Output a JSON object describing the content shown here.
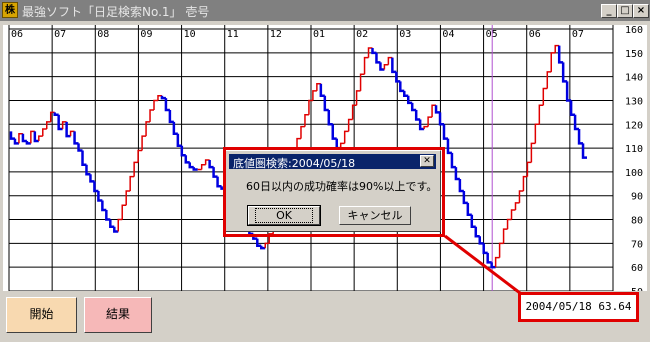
{
  "window": {
    "title": "最強ソフト「日足検索No.1」 壱号",
    "icon": "app-logo-icon",
    "controls": [
      "_",
      "□",
      "×"
    ]
  },
  "chart_data": {
    "type": "line",
    "x_tick_labels": [
      "06",
      "07",
      "08",
      "09",
      "10",
      "11",
      "12",
      "01",
      "02",
      "03",
      "04",
      "05",
      "06",
      "07"
    ],
    "y_tick_labels": [
      "160",
      "150",
      "140",
      "130",
      "120",
      "110",
      "100",
      "90",
      "80",
      "70",
      "60",
      "50"
    ],
    "ylim": [
      50,
      160
    ],
    "grid": true,
    "colors": {
      "up": "#e00000",
      "down": "#0000e0",
      "marker": "#b050d0"
    },
    "marker_label": "2004/05/18",
    "series": [
      {
        "x": [
          0,
          2,
          4,
          6,
          8,
          10,
          12,
          14,
          16,
          18,
          20,
          22,
          24,
          26,
          28,
          30,
          32,
          34,
          36,
          38,
          40,
          42,
          44,
          46,
          48,
          50,
          52,
          54,
          56,
          58,
          60,
          62,
          64,
          66,
          68,
          70,
          72,
          74,
          76,
          78,
          80,
          82,
          84,
          86,
          88,
          90,
          92,
          94,
          96,
          98,
          100,
          102,
          104,
          106,
          108,
          110,
          112,
          114,
          116,
          118,
          120,
          122,
          124,
          126,
          128,
          130,
          132,
          134,
          136,
          138,
          140,
          142,
          144,
          146,
          148,
          150,
          152,
          154,
          156,
          158,
          160,
          162,
          164,
          166,
          168,
          170,
          172,
          174,
          176,
          178,
          180,
          182,
          184,
          186,
          188,
          190,
          192,
          194,
          196,
          198,
          200,
          202,
          204,
          206,
          208,
          210,
          212,
          214,
          216,
          218,
          220,
          222,
          224,
          226,
          228,
          230,
          232,
          234,
          236,
          238,
          240,
          242,
          244,
          246,
          248,
          250,
          252,
          254,
          256,
          258,
          260,
          262,
          264,
          266,
          268,
          270,
          272,
          274,
          276,
          278,
          280,
          282,
          284,
          286,
          288,
          290
        ],
        "values": [
          117,
          114,
          112,
          116,
          113,
          112,
          117,
          113,
          115,
          118,
          121,
          125,
          124,
          118,
          121,
          115,
          117,
          112,
          109,
          103,
          99,
          96,
          92,
          88,
          84,
          80,
          77,
          75,
          80,
          86,
          92,
          98,
          104,
          109,
          115,
          121,
          126,
          130,
          132,
          131,
          126,
          121,
          116,
          111,
          107,
          104,
          102,
          101,
          101,
          103,
          105,
          102,
          98,
          94,
          93,
          94,
          90,
          86,
          82,
          79,
          77,
          74,
          72,
          69,
          68,
          70,
          74,
          80,
          86,
          92,
          98,
          103,
          108,
          114,
          119,
          124,
          130,
          134,
          137,
          132,
          126,
          120,
          114,
          110,
          112,
          117,
          122,
          128,
          134,
          141,
          148,
          152,
          150,
          146,
          143,
          145,
          148,
          142,
          138,
          134,
          132,
          129,
          126,
          122,
          118,
          119,
          123,
          128,
          125,
          120,
          114,
          108,
          102,
          97,
          92,
          87,
          82,
          77,
          73,
          70,
          66,
          62,
          60,
          64,
          70,
          76,
          80,
          84,
          87,
          92,
          98,
          104,
          112,
          120,
          128,
          135,
          142,
          150,
          153,
          146,
          138,
          130,
          124,
          118,
          112,
          106
        ]
      }
    ]
  },
  "dialog": {
    "title": "底値圏検索:2004/05/18",
    "close_glyph": "✕",
    "message": "60日以内の成功確率は90%以上です。",
    "ok_label": "OK",
    "cancel_label": "キャンセル"
  },
  "buttons": {
    "start_label": "開始",
    "result_label": "結果"
  },
  "status": {
    "text": "2004/05/18 63.64"
  }
}
